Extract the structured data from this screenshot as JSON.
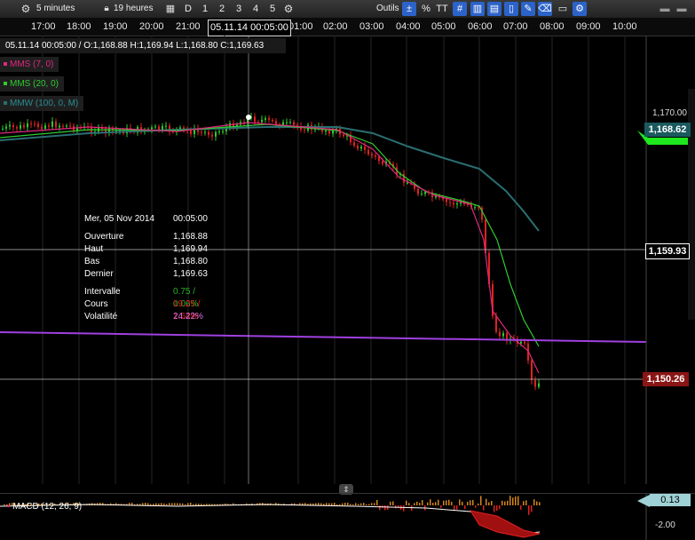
{
  "toolbar": {
    "interval": "5 minutes",
    "range": "19 heures",
    "period_buttons": [
      "D",
      "1",
      "2",
      "3",
      "4",
      "5"
    ],
    "tools_label": "Outils",
    "tool_percent": "%",
    "tool_text": "TT"
  },
  "time_axis": {
    "labels": [
      "17:00",
      "18:00",
      "19:00",
      "20:00",
      "21:00",
      "01:00",
      "02:00",
      "03:00",
      "04:00",
      "05:00",
      "06:00",
      "07:00",
      "08:00",
      "09:00",
      "10:00"
    ],
    "cursor": "05.11.14 00:05:00"
  },
  "legend": {
    "ohlc": "05.11.14 00:05:00 / O:1,168.88  H:1,169.94  L:1,168.80  C:1,169.63",
    "indicators": [
      {
        "label": "MMS (7, 0)",
        "color": "#e0287e"
      },
      {
        "label": "MMS (20, 0)",
        "color": "#2ecc2e"
      },
      {
        "label": "MMW (100, 0, M)",
        "color": "#2a6e72"
      }
    ]
  },
  "tooltip": {
    "date": "Mer, 05 Nov 2014",
    "time": "00:05:00",
    "rows": [
      {
        "k": "Ouverture",
        "v": "1,168.88"
      },
      {
        "k": "Haut",
        "v": "1,169.94"
      },
      {
        "k": "Bas",
        "v": "1,168.80"
      },
      {
        "k": "Dernier",
        "v": "1,169.63"
      }
    ],
    "stats": [
      {
        "k": "Intervalle",
        "v": "0.75 / 0.06%",
        "color": "#27b327"
      },
      {
        "k": "Cours",
        "v": "19.25 / 1.64%",
        "color": "#e02020"
      },
      {
        "k": "Volatilité",
        "v": "24.22%",
        "color": "#e070e0"
      }
    ]
  },
  "price_axis": {
    "tick": "1,170.00",
    "tag_ma100": "1,168.62",
    "tag_crosshair": "1,159.93",
    "tag_last": "1,150.26"
  },
  "macd": {
    "label": "MACD (12, 26, 9)",
    "tag": "0.13",
    "tick": "-2.00"
  },
  "chart_data": {
    "type": "candlestick",
    "instrument_interval": "5 minutes",
    "cursor": {
      "time": "05.11.14 00:05:00",
      "open": 1168.88,
      "high": 1169.94,
      "low": 1168.8,
      "close": 1169.63
    },
    "series": [
      {
        "name": "MMS (7, 0)",
        "color": "#e0287e"
      },
      {
        "name": "MMS (20, 0)",
        "color": "#2ecc2e"
      },
      {
        "name": "MMW (100, 0, M)",
        "color": "#2a6e72"
      }
    ],
    "price_levels": [
      1170.0,
      1168.62,
      1159.93,
      1150.26
    ],
    "colors": {
      "up": "#2ecc2e",
      "down": "#e02020",
      "support_line": "#a040e0"
    }
  }
}
